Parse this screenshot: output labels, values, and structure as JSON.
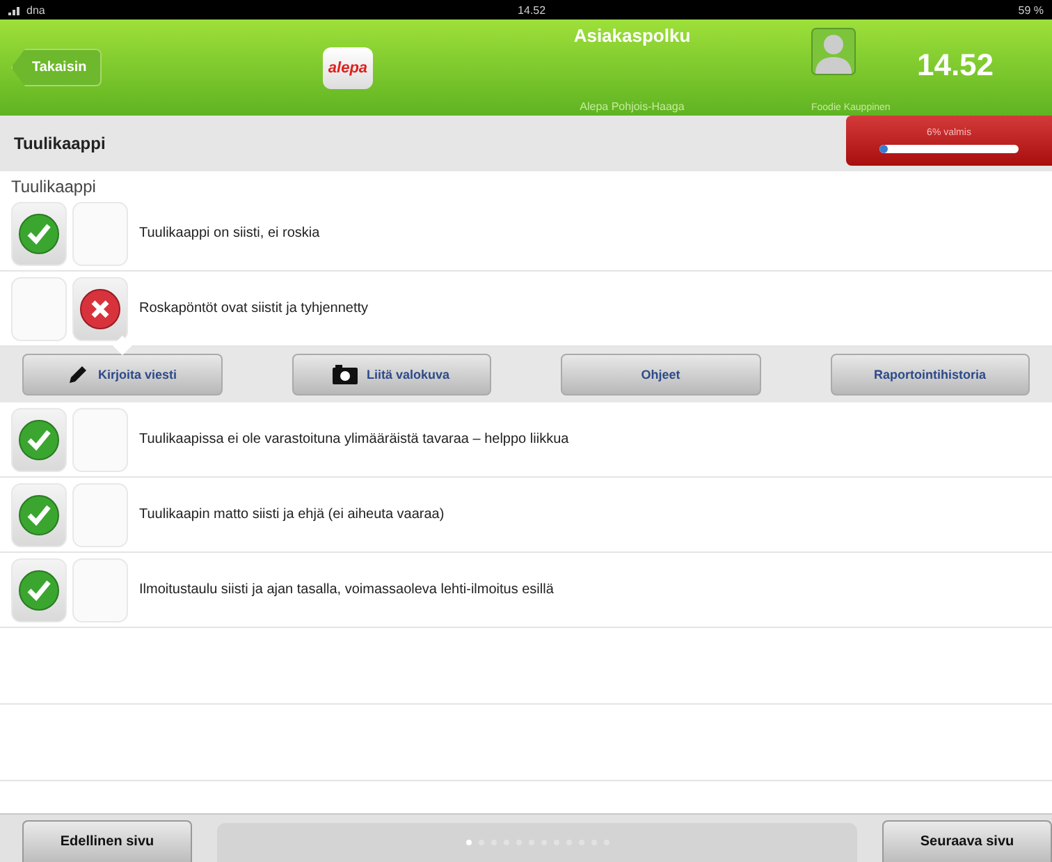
{
  "status_bar": {
    "carrier": "dna",
    "time": "14.52",
    "battery": "59 %"
  },
  "header": {
    "back": "Takaisin",
    "logo": "alepa",
    "title": "Asiakaspolku",
    "subtitle": "Alepa Pohjois-Haaga",
    "clock": "14.52",
    "user": "Foodie Kauppinen"
  },
  "section": {
    "title": "Tuulikaappi",
    "progress": {
      "label": "6% valmis",
      "level": 0.06
    }
  },
  "group_title": "Tuulikaappi",
  "items": [
    {
      "text": "Tuulikaappi on siisti, ei roskia",
      "yes": true,
      "no": false
    },
    {
      "text": "Roskapöntöt ovat siistit ja tyhjennetty",
      "yes": false,
      "no": true,
      "actions": [
        {
          "kind": "pencil",
          "label": "Kirjoita viesti"
        },
        {
          "kind": "camera",
          "label": "Liitä valokuva"
        },
        {
          "kind": "plain",
          "label": "Ohjeet"
        },
        {
          "kind": "plain",
          "label": "Raportointihistoria"
        }
      ]
    },
    {
      "text": "Tuulikaapissa ei ole varastoituna ylimääräistä tavaraa – helppo liikkua",
      "yes": true,
      "no": false
    },
    {
      "text": "Tuulikaapin matto siisti ja ehjä (ei aiheuta vaaraa)",
      "yes": true,
      "no": false
    },
    {
      "text": "Ilmoitustaulu siisti ja ajan tasalla, voimassaoleva lehti-ilmoitus esillä",
      "yes": true,
      "no": false
    }
  ],
  "footer": {
    "previous": "Edellinen sivu",
    "next": "Seuraava sivu",
    "pages": [
      {
        "selected": true
      },
      {
        "selected": false
      },
      {
        "selected": false
      },
      {
        "selected": false
      },
      {
        "selected": false
      },
      {
        "selected": false
      },
      {
        "selected": false
      },
      {
        "selected": false
      },
      {
        "selected": false
      },
      {
        "selected": false
      },
      {
        "selected": false
      },
      {
        "selected": false
      }
    ]
  }
}
